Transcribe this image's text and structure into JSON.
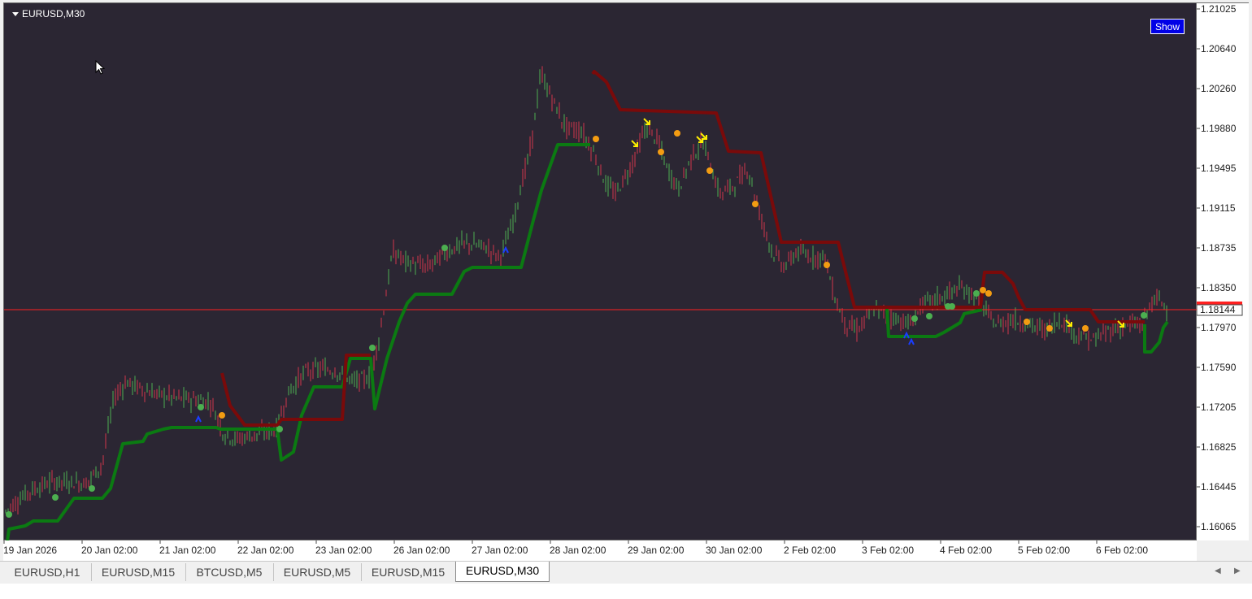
{
  "chart": {
    "symbol_title": "EURUSD,M30",
    "show_button": "Show",
    "current_price": "1.18144",
    "price_ticks": [
      "1.21025",
      "1.20640",
      "1.20260",
      "1.19880",
      "1.19495",
      "1.19115",
      "1.18735",
      "1.18350",
      "1.17970",
      "1.17590",
      "1.17205",
      "1.16825",
      "1.16445",
      "1.16065"
    ],
    "time_ticks": [
      "19 Jan 2026",
      "20 Jan 02:00",
      "21 Jan 02:00",
      "22 Jan 02:00",
      "23 Jan 02:00",
      "26 Jan 02:00",
      "27 Jan 02:00",
      "28 Jan 02:00",
      "29 Jan 02:00",
      "30 Jan 02:00",
      "2 Feb 02:00",
      "3 Feb 02:00",
      "4 Feb 02:00",
      "5 Feb 02:00",
      "6 Feb 02:00"
    ],
    "colors": {
      "background": "#2b2633",
      "bull_candle": "#4caf50",
      "bear_candle": "#d2374b",
      "support_line": "#0b7a12",
      "resistance_line": "#7a0a0a",
      "bid_line": "#ff2020",
      "arrow_marker": "#ffee00",
      "orange_dot": "#f39c12",
      "green_dot": "#4caf50",
      "blue_marker": "#1a3dff"
    },
    "icons": [
      "dropdown-triangle-icon",
      "mouse-cursor-icon"
    ]
  },
  "tabs": [
    {
      "label": "EURUSD,H1"
    },
    {
      "label": "EURUSD,M15"
    },
    {
      "label": "BTCUSD,M5"
    },
    {
      "label": "EURUSD,M5"
    },
    {
      "label": "EURUSD,M15"
    },
    {
      "label": "EURUSD,M30"
    }
  ],
  "active_tab": "EURUSD,M30",
  "scroll_icons": [
    "scroll-left-icon",
    "scroll-right-icon"
  ]
}
